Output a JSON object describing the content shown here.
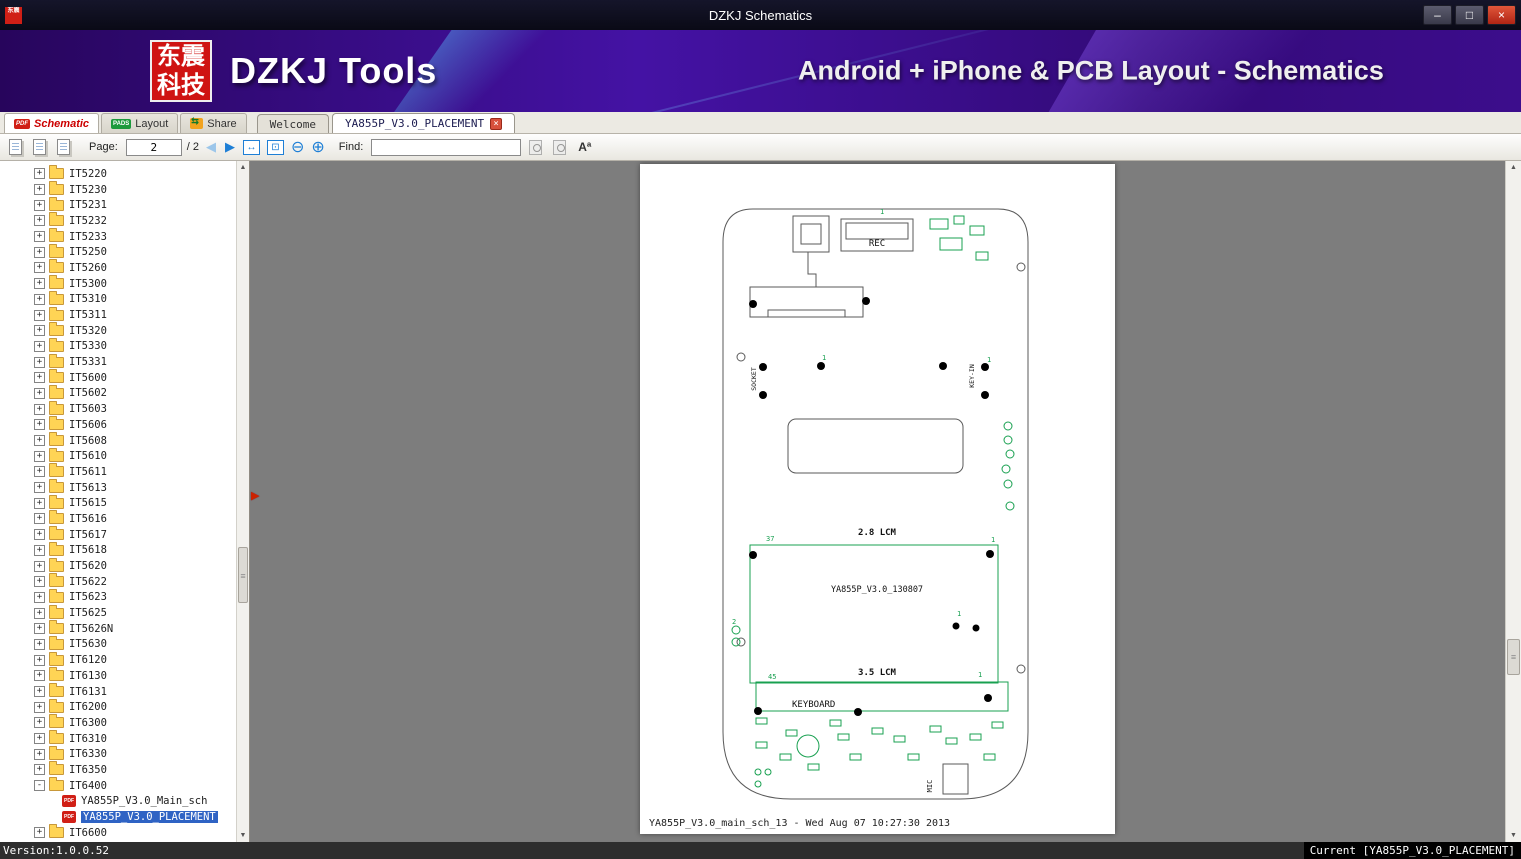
{
  "window": {
    "title": "DZKJ Schematics"
  },
  "icons": {
    "minimize": "–",
    "maximize": "□",
    "close": "×",
    "back": "◀",
    "forward": "▶",
    "fit_width": "↔",
    "fit_page": "⊡",
    "zoom_out": "⊖",
    "zoom_in": "⊕",
    "doc_close": "×",
    "scroll_up": "▲",
    "scroll_down": "▼",
    "grip": "≡",
    "splitter": "▶",
    "font_size": "Aª",
    "expand": "+",
    "collapse": "-"
  },
  "header": {
    "logo_cn_1": "东震",
    "logo_cn_2": "科技",
    "logo_title": "DZKJ Tools",
    "subtitle": "Android + iPhone & PCB Layout - Schematics"
  },
  "main_tabs": [
    {
      "label": "Schematic",
      "badge": "PDF"
    },
    {
      "label": "Layout",
      "badge": "PADS"
    },
    {
      "label": "Share",
      "badge": ""
    }
  ],
  "doc_tabs": [
    {
      "label": "Welcome"
    },
    {
      "label": "YA855P_V3.0_PLACEMENT"
    }
  ],
  "toolbar": {
    "page_label": "Page:",
    "page_value": "2",
    "page_total": "/ 2",
    "find_label": "Find:",
    "find_value": ""
  },
  "sidebar": {
    "folders_before": [
      "IT5220",
      "IT5230",
      "IT5231",
      "IT5232",
      "IT5233",
      "IT5250",
      "IT5260",
      "IT5300",
      "IT5310",
      "IT5311",
      "IT5320",
      "IT5330",
      "IT5331",
      "IT5600",
      "IT5602",
      "IT5603",
      "IT5606",
      "IT5608",
      "IT5610",
      "IT5611",
      "IT5613",
      "IT5615",
      "IT5616",
      "IT5617",
      "IT5618",
      "IT5620",
      "IT5622",
      "IT5623",
      "IT5625",
      "IT5626N",
      "IT5630",
      "IT6120",
      "IT6130",
      "IT6131",
      "IT6200",
      "IT6300",
      "IT6310",
      "IT6330",
      "IT6350"
    ],
    "expanded_folder": "IT6400",
    "children": [
      {
        "label": "YA855P_V3.0_Main_sch",
        "selected": false
      },
      {
        "label": "YA855P_V3.0_PLACEMENT",
        "selected": true
      }
    ],
    "folders_after": [
      "IT6600"
    ]
  },
  "drawing": {
    "labels": {
      "rec": "REC",
      "socket": "SOCKET",
      "key_in": "KEY-IN",
      "lcm_28": "2.8 LCM",
      "board_name": "YA855P_V3.0_130807",
      "lcm_35": "3.5 LCM",
      "keyboard": "KEYBOARD",
      "mic": "MIC"
    },
    "pins": {
      "p37": "37",
      "p45": "45",
      "p1": "1",
      "p2": "2"
    },
    "footer": "YA855P_V3.0_main_sch_13 - Wed Aug 07 10:27:30 2013"
  },
  "statusbar": {
    "version": "Version:1.0.0.52",
    "current": "Current [YA855P_V3.0_PLACEMENT]"
  },
  "colors": {
    "accent_green": "#18a050",
    "pdf_red": "#d01f16",
    "selection_blue": "#2f63c4"
  }
}
